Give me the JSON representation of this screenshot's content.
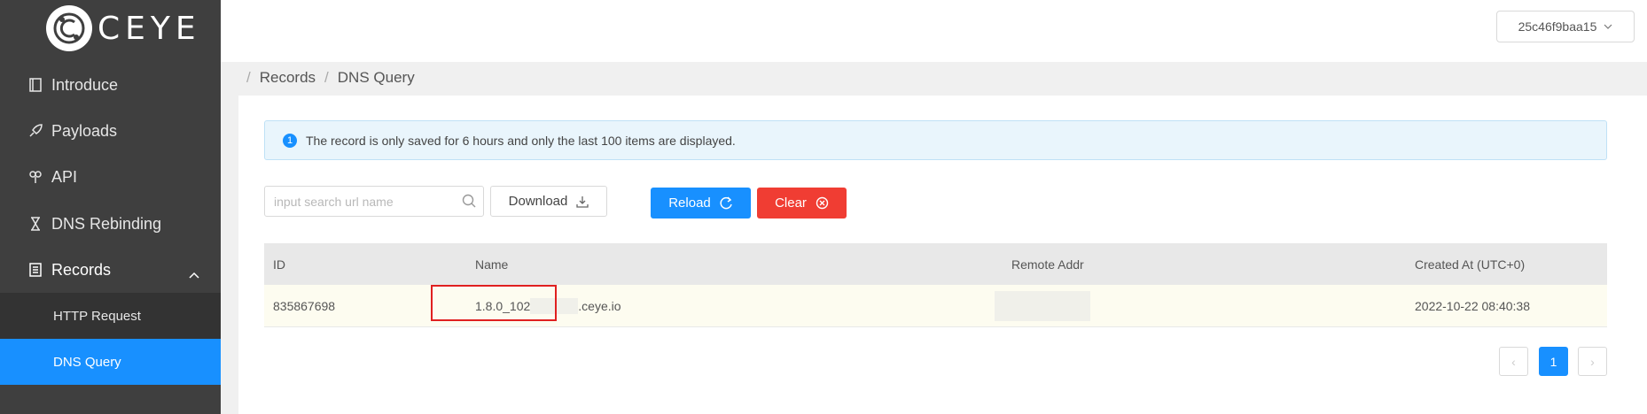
{
  "logo": {
    "text": "CEYE"
  },
  "sidebar": {
    "items": [
      {
        "label": "Introduce",
        "icon": "book-icon"
      },
      {
        "label": "Payloads",
        "icon": "rocket-icon"
      },
      {
        "label": "API",
        "icon": "api-icon"
      },
      {
        "label": "DNS Rebinding",
        "icon": "hourglass-icon"
      },
      {
        "label": "Records",
        "icon": "records-icon"
      }
    ],
    "sub_items": [
      {
        "label": "HTTP Request"
      },
      {
        "label": "DNS Query"
      }
    ]
  },
  "header": {
    "user": "25c46f9baa15"
  },
  "breadcrumb": {
    "root": "Records",
    "current": "DNS Query"
  },
  "alert": {
    "icon_text": "1",
    "text": "The record is only saved for 6 hours and only the last 100 items are displayed."
  },
  "toolbar": {
    "search_placeholder": "input search url name",
    "download_label": "Download",
    "reload_label": "Reload",
    "clear_label": "Clear"
  },
  "table": {
    "columns": [
      "ID",
      "Name",
      "Remote Addr",
      "Created At (UTC+0)"
    ],
    "rows": [
      {
        "id": "835867698",
        "name_prefix": "1.8.0_102",
        "name_suffix": ".ceye.io",
        "remote_addr": "",
        "created_at": "2022-10-22 08:40:38"
      }
    ]
  },
  "pagination": {
    "current_page": "1",
    "prev": "‹",
    "next": "›"
  },
  "colors": {
    "primary": "#1890ff",
    "danger": "#f03d33",
    "sidebar": "#3f3f3f"
  }
}
